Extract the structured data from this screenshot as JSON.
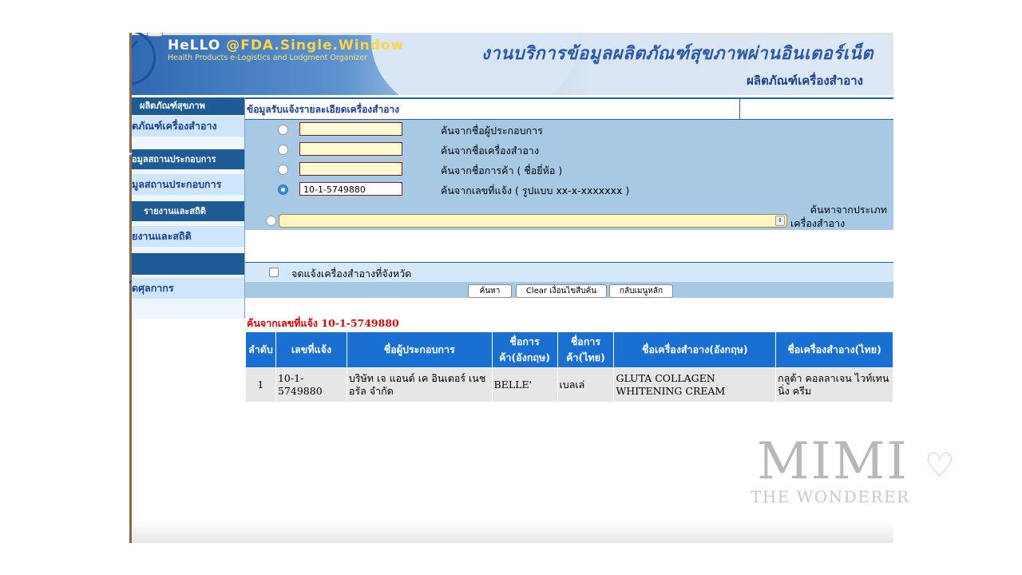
{
  "header": {
    "logo_main_a": "HeLLO",
    "logo_main_b": "@FDA.Single.Window",
    "logo_sub": "Health Products e-Logistics and Lodgment Organizer",
    "title": "งานบริการข้อมูลผลิตภัณฑ์สุขภาพผ่านอินเตอร์เน็ต",
    "subtitle": "ผลิตภัณฑ์เครื่องสำอาง"
  },
  "sidebar": {
    "items": [
      {
        "label": "ผลิตภัณฑ์สุขภาพ",
        "type": "header"
      },
      {
        "label": "ตภัณฑ์เครื่องสำอาง",
        "type": "item"
      },
      {
        "label": "้อมูลสถานประกอบการ",
        "type": "header"
      },
      {
        "label": "มูลสถานประกอบการ",
        "type": "item"
      },
      {
        "label": "รายงานและสถิติ",
        "type": "header"
      },
      {
        "label": "ยงานและสถิติ",
        "type": "item"
      },
      {
        "label": "",
        "type": "blank"
      },
      {
        "label": "์ดศุลกากร",
        "type": "item"
      }
    ]
  },
  "breadcrumb": "ข้อมูลรับแจ้งรายละเอียดเครื่องสำอาง",
  "search": {
    "options": [
      {
        "label": "ค้นจากชื่อผู้ประกอบการ",
        "value": "",
        "selected": false
      },
      {
        "label": "ค้นจากชื่อเครื่องสำอาง",
        "value": "",
        "selected": false
      },
      {
        "label": "ค้นจากชื่อการค้า ( ชื่อยี่ห้อ )",
        "value": "",
        "selected": false
      },
      {
        "label": "ค้นจากเลขที่แจ้ง ( รูปแบบ xx-x-xxxxxxx )",
        "value": "10-1-5749880",
        "selected": true
      }
    ],
    "category_label_1": "ค้นหาจากประเภท",
    "category_label_2": "เครื่องสำอาง",
    "category_value": "",
    "province_label": "จดแจ้งเครื่องสำอางที่จังหวัด",
    "buttons": {
      "search": "ค้นหา",
      "clear": "Clear เงื่อนไขสืบค้น",
      "back": "กลับเมนูหลัก"
    }
  },
  "results": {
    "title": "ค้นจากเลขที่แจ้ง 10-1-5749880",
    "columns": [
      "ลำดับ",
      "เลขที่แจ้ง",
      "ชื่อผู้ประกอบการ",
      "ชื่อการค้า(อังกฤษ)",
      "ชื่อการค้า(ไทย)",
      "ชื่อเครื่องสำอาง(อังกฤษ)",
      "ชื่อเครื่องสำอาง(ไทย)"
    ],
    "rows": [
      [
        "1",
        "10-1-5749880",
        "บริษัท เจ แอนด์ เค อินเตอร์ เนชอรัล จำกัด",
        "BELLE'",
        "เบลเล่",
        "GLUTA COLLAGEN WHITENING CREAM",
        "กลูต้า คอลลาเจน ไวท์เทนนิ่ง ครีม"
      ]
    ]
  },
  "watermark": {
    "big": "MIMI",
    "heart": "♡",
    "small": "THE WONDERER"
  },
  "colors": {
    "header_blue": "#2f69b3",
    "table_header": "#1a6fd3",
    "result_red": "#e00000",
    "form_bg": "#a7c9e4"
  }
}
